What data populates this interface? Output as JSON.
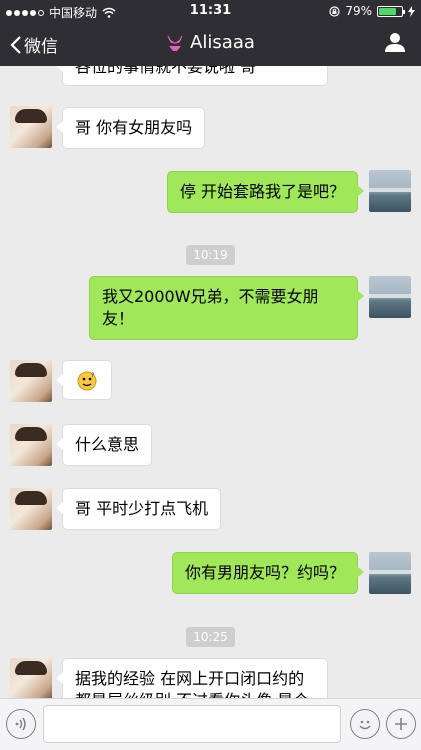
{
  "status": {
    "carrier": "中国移动",
    "time": "11:31",
    "battery": "79%",
    "battery_level": 0.79
  },
  "nav": {
    "back_label": "微信",
    "title": "Alisaaa"
  },
  "messages": [
    {
      "side": "left",
      "text": "各位的事情就不要说啦 哥"
    },
    {
      "side": "left",
      "text": "哥 你有女朋友吗"
    },
    {
      "side": "right",
      "text": "停  开始套路我了是吧？"
    },
    {
      "timestamp": "10:19"
    },
    {
      "side": "right",
      "text": "我又2000W兄弟，不需要女朋友！"
    },
    {
      "side": "left",
      "sticker": "emoji-sticker"
    },
    {
      "side": "left",
      "text": "什么意思"
    },
    {
      "side": "left",
      "text": "哥 平时少打点飞机"
    },
    {
      "side": "right",
      "text": "你有男朋友吗？约吗？"
    },
    {
      "timestamp": "10:25"
    },
    {
      "side": "left",
      "text": "据我的经验 在网上开口闭口约的都是屌丝级别 不过看你头像 是个"
    }
  ],
  "icons": {
    "voice": "voice-icon",
    "emoji": "emoji-icon",
    "plus": "plus-icon",
    "back": "chevron-left-icon",
    "profile": "profile-icon",
    "title_badge": "bikini-icon"
  },
  "colors": {
    "bar": "#2e2e33",
    "bubble_me": "#a0e75a",
    "bubble_them": "#ffffff",
    "background": "#ebebeb"
  }
}
